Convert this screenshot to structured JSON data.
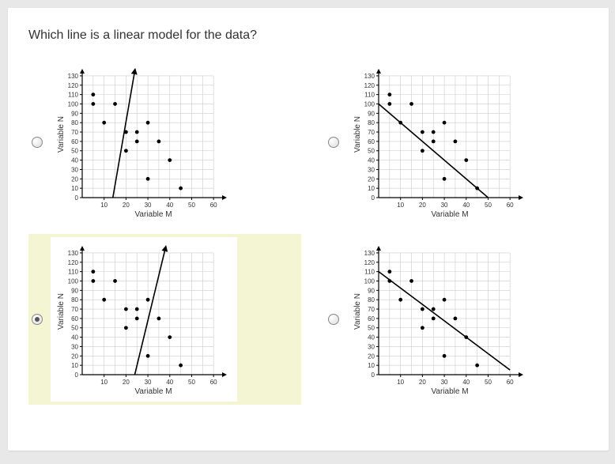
{
  "question": "Which line is a linear model for the data?",
  "selected_index": 2,
  "shared_scatter": {
    "xlabel": "Variable M",
    "ylabel": "Variable N",
    "x_ticks": [
      10,
      20,
      30,
      40,
      50,
      60
    ],
    "y_ticks": [
      0,
      10,
      20,
      30,
      40,
      50,
      60,
      70,
      80,
      90,
      100,
      110,
      120,
      130
    ],
    "points": [
      {
        "x": 5,
        "y": 110
      },
      {
        "x": 5,
        "y": 100
      },
      {
        "x": 10,
        "y": 80
      },
      {
        "x": 15,
        "y": 100
      },
      {
        "x": 20,
        "y": 50
      },
      {
        "x": 20,
        "y": 70
      },
      {
        "x": 25,
        "y": 70
      },
      {
        "x": 25,
        "y": 60
      },
      {
        "x": 30,
        "y": 80
      },
      {
        "x": 30,
        "y": 20
      },
      {
        "x": 35,
        "y": 60
      },
      {
        "x": 40,
        "y": 40
      },
      {
        "x": 45,
        "y": 10
      }
    ]
  },
  "chart_data": [
    {
      "type": "scatter",
      "title": "",
      "xlabel": "Variable M",
      "ylabel": "Variable N",
      "xlim": [
        0,
        65
      ],
      "ylim": [
        0,
        135
      ],
      "line": {
        "x1": 14,
        "y1": 0,
        "x2": 24,
        "y2": 135,
        "has_arrow": true
      }
    },
    {
      "type": "scatter",
      "title": "",
      "xlabel": "Variable M",
      "ylabel": "Variable N",
      "xlim": [
        0,
        65
      ],
      "ylim": [
        0,
        135
      ],
      "line": {
        "x1": 0,
        "y1": 100,
        "x2": 50,
        "y2": 0,
        "has_arrow": false
      }
    },
    {
      "type": "scatter",
      "title": "",
      "xlabel": "Variable M",
      "ylabel": "Variable N",
      "xlim": [
        0,
        65
      ],
      "ylim": [
        0,
        135
      ],
      "line": {
        "x1": 24,
        "y1": 0,
        "x2": 38,
        "y2": 135,
        "has_arrow": true
      }
    },
    {
      "type": "scatter",
      "title": "",
      "xlabel": "Variable M",
      "ylabel": "Variable N",
      "xlim": [
        0,
        65
      ],
      "ylim": [
        0,
        135
      ],
      "line": {
        "x1": 0,
        "y1": 110,
        "x2": 60,
        "y2": 5,
        "has_arrow": false
      }
    }
  ]
}
